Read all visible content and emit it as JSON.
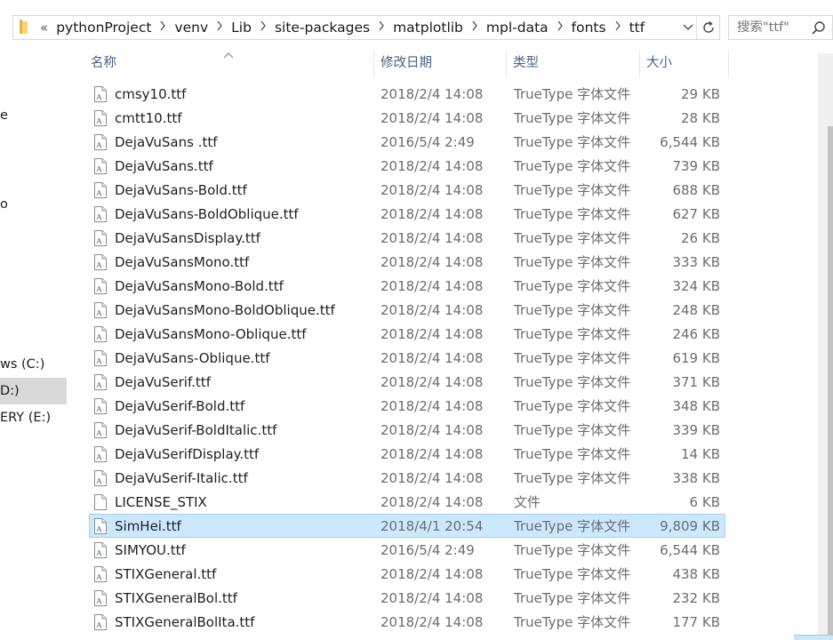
{
  "address_bar": {
    "overflow": "«",
    "crumbs": [
      "pythonProject",
      "venv",
      "Lib",
      "site-packages",
      "matplotlib",
      "mpl-data",
      "fonts",
      "ttf"
    ]
  },
  "search": {
    "placeholder": "搜索\"ttf\""
  },
  "sidebar": {
    "items": [
      "e",
      "o",
      "ws (C:)",
      "D:)",
      "ERY (E:)"
    ],
    "selected_index": 3
  },
  "columns": {
    "name": "名称",
    "date": "修改日期",
    "type": "类型",
    "size": "大小"
  },
  "files": [
    {
      "name": "cmsy10.ttf",
      "date": "2018/2/4 14:08",
      "type": "TrueType 字体文件",
      "size": "29 KB",
      "icon": "font-file-icon"
    },
    {
      "name": "cmtt10.ttf",
      "date": "2018/2/4 14:08",
      "type": "TrueType 字体文件",
      "size": "28 KB",
      "icon": "font-file-icon"
    },
    {
      "name": "DejaVuSans .ttf",
      "date": "2016/5/4 2:49",
      "type": "TrueType 字体文件",
      "size": "6,544 KB",
      "icon": "font-file-icon"
    },
    {
      "name": "DejaVuSans.ttf",
      "date": "2018/2/4 14:08",
      "type": "TrueType 字体文件",
      "size": "739 KB",
      "icon": "font-file-icon"
    },
    {
      "name": "DejaVuSans-Bold.ttf",
      "date": "2018/2/4 14:08",
      "type": "TrueType 字体文件",
      "size": "688 KB",
      "icon": "font-file-icon"
    },
    {
      "name": "DejaVuSans-BoldOblique.ttf",
      "date": "2018/2/4 14:08",
      "type": "TrueType 字体文件",
      "size": "627 KB",
      "icon": "font-file-icon"
    },
    {
      "name": "DejaVuSansDisplay.ttf",
      "date": "2018/2/4 14:08",
      "type": "TrueType 字体文件",
      "size": "26 KB",
      "icon": "font-file-icon"
    },
    {
      "name": "DejaVuSansMono.ttf",
      "date": "2018/2/4 14:08",
      "type": "TrueType 字体文件",
      "size": "333 KB",
      "icon": "font-file-icon"
    },
    {
      "name": "DejaVuSansMono-Bold.ttf",
      "date": "2018/2/4 14:08",
      "type": "TrueType 字体文件",
      "size": "324 KB",
      "icon": "font-file-icon"
    },
    {
      "name": "DejaVuSansMono-BoldOblique.ttf",
      "date": "2018/2/4 14:08",
      "type": "TrueType 字体文件",
      "size": "248 KB",
      "icon": "font-file-icon"
    },
    {
      "name": "DejaVuSansMono-Oblique.ttf",
      "date": "2018/2/4 14:08",
      "type": "TrueType 字体文件",
      "size": "246 KB",
      "icon": "font-file-icon"
    },
    {
      "name": "DejaVuSans-Oblique.ttf",
      "date": "2018/2/4 14:08",
      "type": "TrueType 字体文件",
      "size": "619 KB",
      "icon": "font-file-icon"
    },
    {
      "name": "DejaVuSerif.ttf",
      "date": "2018/2/4 14:08",
      "type": "TrueType 字体文件",
      "size": "371 KB",
      "icon": "font-file-icon"
    },
    {
      "name": "DejaVuSerif-Bold.ttf",
      "date": "2018/2/4 14:08",
      "type": "TrueType 字体文件",
      "size": "348 KB",
      "icon": "font-file-icon"
    },
    {
      "name": "DejaVuSerif-BoldItalic.ttf",
      "date": "2018/2/4 14:08",
      "type": "TrueType 字体文件",
      "size": "339 KB",
      "icon": "font-file-icon"
    },
    {
      "name": "DejaVuSerifDisplay.ttf",
      "date": "2018/2/4 14:08",
      "type": "TrueType 字体文件",
      "size": "14 KB",
      "icon": "font-file-icon"
    },
    {
      "name": "DejaVuSerif-Italic.ttf",
      "date": "2018/2/4 14:08",
      "type": "TrueType 字体文件",
      "size": "338 KB",
      "icon": "font-file-icon"
    },
    {
      "name": "LICENSE_STIX",
      "date": "2018/2/4 14:08",
      "type": "文件",
      "size": "6 KB",
      "icon": "blank-file-icon"
    },
    {
      "name": "SimHei.ttf",
      "date": "2018/4/1 20:54",
      "type": "TrueType 字体文件",
      "size": "9,809 KB",
      "icon": "font-file-icon"
    },
    {
      "name": "SIMYOU.ttf",
      "date": "2016/5/4 2:49",
      "type": "TrueType 字体文件",
      "size": "6,544 KB",
      "icon": "font-file-icon"
    },
    {
      "name": "STIXGeneral.ttf",
      "date": "2018/2/4 14:08",
      "type": "TrueType 字体文件",
      "size": "438 KB",
      "icon": "font-file-icon"
    },
    {
      "name": "STIXGeneralBol.ttf",
      "date": "2018/2/4 14:08",
      "type": "TrueType 字体文件",
      "size": "232 KB",
      "icon": "font-file-icon"
    },
    {
      "name": "STIXGeneralBolIta.ttf",
      "date": "2018/2/4 14:08",
      "type": "TrueType 字体文件",
      "size": "177 KB",
      "icon": "font-file-icon"
    }
  ],
  "selected_file_index": 18,
  "colors": {
    "selection_fill": "#cce8ff",
    "selection_border": "#99d1ff",
    "header_text": "#4d6082",
    "secondary_text": "#6d6d6d",
    "sidebar_selected": "#d9d9d9"
  }
}
